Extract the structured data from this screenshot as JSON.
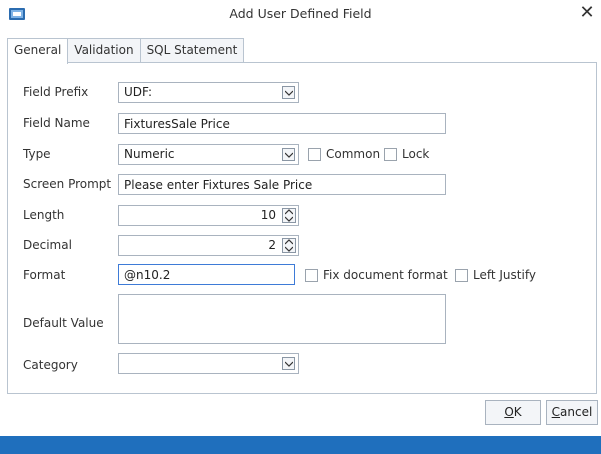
{
  "window": {
    "title": "Add User Defined Field"
  },
  "tabs": [
    {
      "label": "General"
    },
    {
      "label": "Validation"
    },
    {
      "label": "SQL Statement"
    }
  ],
  "form": {
    "field_prefix": {
      "label": "Field Prefix",
      "value": "UDF:"
    },
    "field_name": {
      "label": "Field Name",
      "value": "FixturesSale Price"
    },
    "type": {
      "label": "Type",
      "value": "Numeric"
    },
    "common": {
      "label": "Common",
      "checked": false
    },
    "lock": {
      "label": "Lock",
      "checked": false
    },
    "screen_prompt": {
      "label": "Screen Prompt",
      "value": "Please enter Fixtures Sale Price"
    },
    "length": {
      "label": "Length",
      "value": "10"
    },
    "decimal": {
      "label": "Decimal",
      "value": "2"
    },
    "format": {
      "label": "Format",
      "value": "@n10.2"
    },
    "fix_document_format": {
      "label": "Fix document format",
      "checked": false
    },
    "left_justify": {
      "label": "Left Justify",
      "checked": false
    },
    "default_value": {
      "label": "Default Value",
      "value": ""
    },
    "category": {
      "label": "Category",
      "value": ""
    }
  },
  "buttons": {
    "ok": {
      "accel": "O",
      "rest": "K"
    },
    "cancel": {
      "accel": "C",
      "rest": "ancel"
    }
  }
}
